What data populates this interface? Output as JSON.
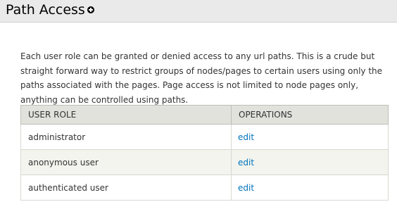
{
  "header": {
    "title": "Path Access",
    "add_icon": "plus-circle-icon"
  },
  "description": "Each user role can be granted or denied access to any url paths. This is a crude but straight forward way to restrict groups of nodes/pages to certain users using only the paths associated with the pages. Page access is not limited to node pages only, anything can be controlled using paths.",
  "table": {
    "headers": [
      "USER ROLE",
      "OPERATIONS"
    ],
    "rows": [
      {
        "role": "administrator",
        "operation": "edit"
      },
      {
        "role": "anonymous user",
        "operation": "edit"
      },
      {
        "role": "authenticated user",
        "operation": "edit"
      }
    ]
  },
  "colors": {
    "header_bg": "#eaeaea",
    "table_header_bg": "#e1e2dc",
    "striped_row_bg": "#f3f4ee",
    "link": "#0074bd"
  }
}
